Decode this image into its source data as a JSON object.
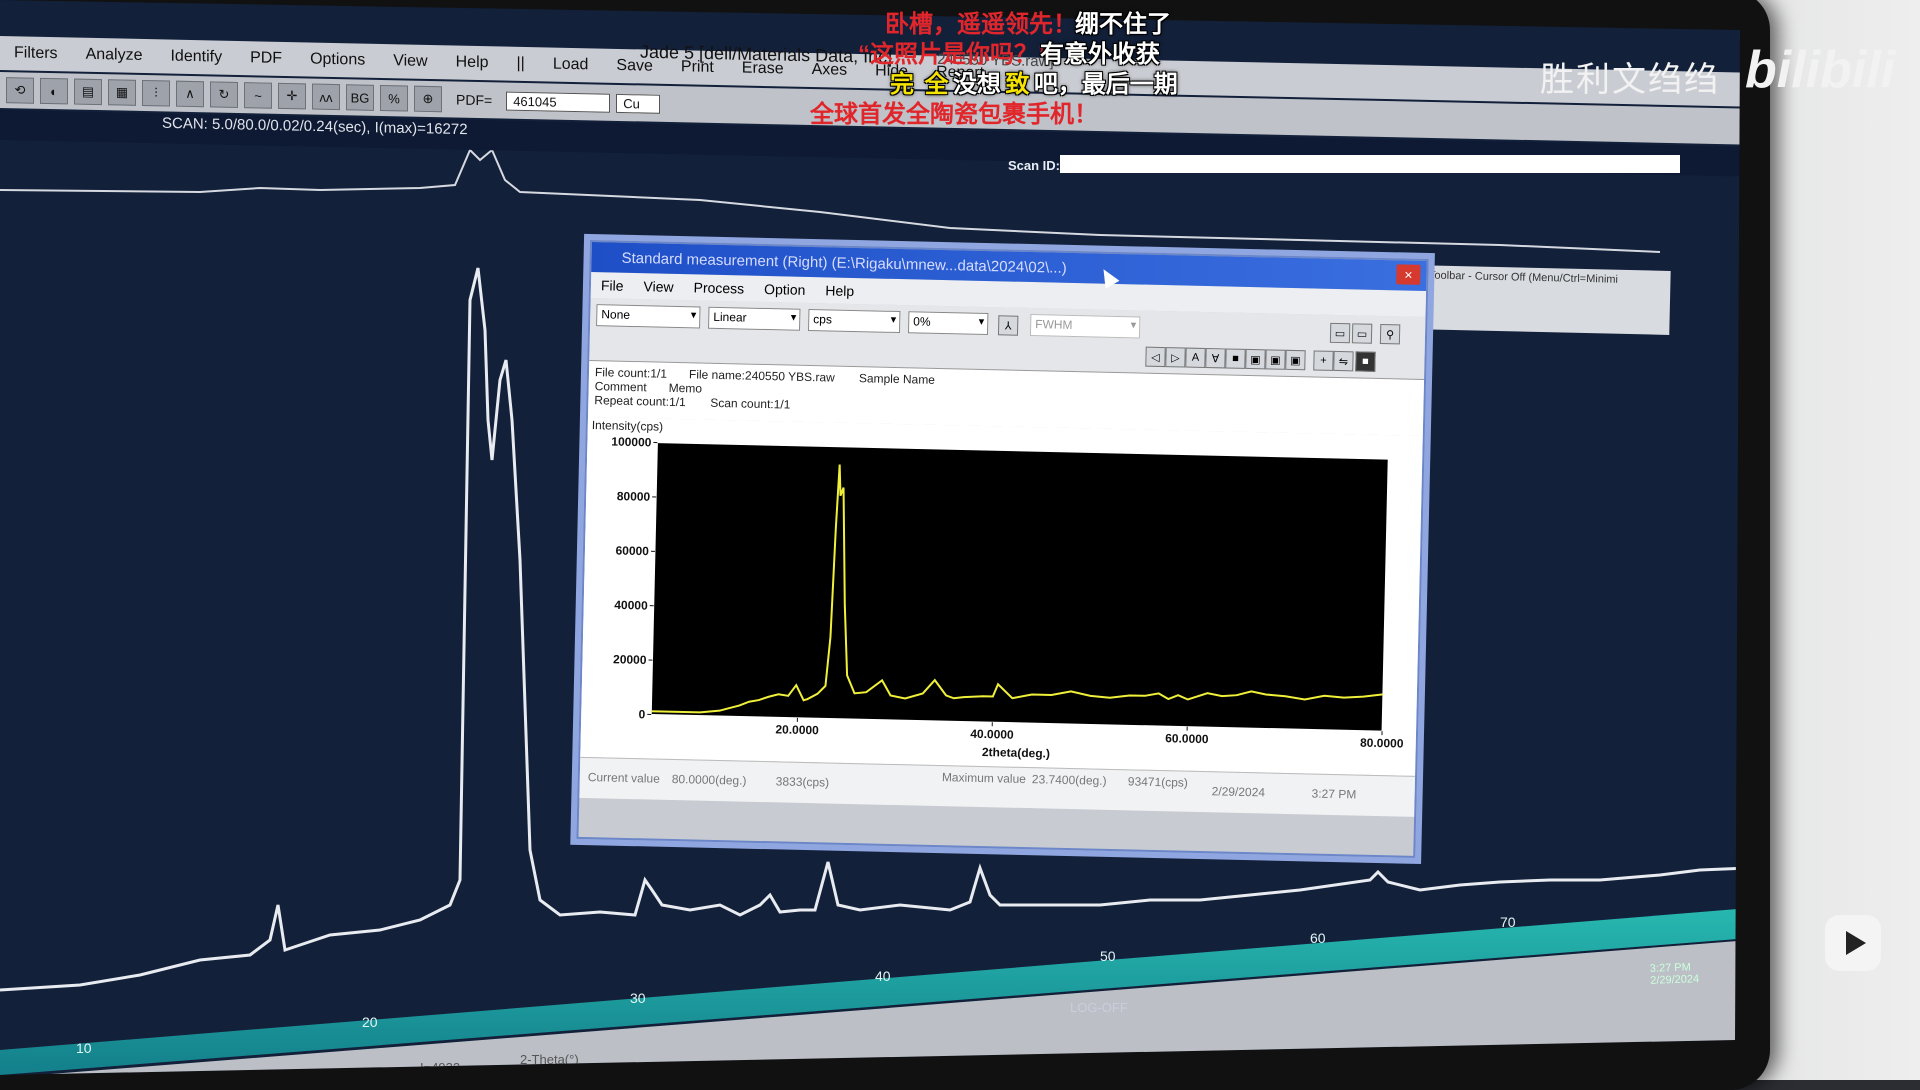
{
  "jade": {
    "menu": [
      "Filters",
      "Analyze",
      "Identify",
      "PDF",
      "Options",
      "View",
      "Help",
      "||",
      "Load",
      "Save",
      "Print",
      "Erase",
      "Axes",
      "Hide",
      "Report"
    ],
    "title": "Jade 5 [dell/Materials Data, Inc]",
    "title_tail": "240550 YBS.raw]",
    "pdf_label": "PDF=",
    "pdf_value": "461045",
    "target_value": "Cu",
    "scan_text": "SCAN: 5.0/80.0/0.02/0.24(sec), I(max)=16272",
    "scan_id_label": "Scan ID:",
    "edit_toolbar_text": "dit Toolbar - Cursor Off (Menu/Ctrl=Minimi",
    "axis_ticks": [
      "10",
      "20",
      "30",
      "40",
      "50",
      "60",
      "70"
    ],
    "bottom_label_a": "I=4932",
    "bottom_label_b": "2-Theta(°)",
    "log_off": "LOG-OFF",
    "tray_time": "3:27 PM",
    "tray_date": "2/29/2024"
  },
  "standard_measurement": {
    "title": "Standard measurement (Right) (E:\\Rigaku\\mnew...data\\2024\\02\\...)",
    "close": "×",
    "menu": [
      "File",
      "View",
      "Process",
      "Option",
      "Help"
    ],
    "dropdowns": [
      "None",
      "Linear",
      "cps",
      "0%"
    ],
    "fwhm": "FWHM",
    "info": {
      "file_count": "File count:1/1",
      "file_name": "File name:240550 YBS.raw",
      "sample_name": "Sample Name",
      "comment": "Comment",
      "memo": "Memo",
      "repeat_count": "Repeat count:1/1",
      "scan_count": "Scan count:1/1"
    },
    "status": {
      "current_label": "Current value",
      "current_deg": "80.0000(deg.)",
      "current_cps": "3833(cps)",
      "max_label": "Maximum value",
      "max_deg": "23.7400(deg.)",
      "max_cps": "93471(cps)",
      "date": "2/29/2024",
      "time": "3:27 PM"
    }
  },
  "chart_data": {
    "type": "line",
    "ylabel": "Intensity(cps)",
    "xlabel": "2theta(deg.)",
    "xlim": [
      5,
      80
    ],
    "ylim": [
      0,
      100000
    ],
    "x_ticks": [
      "20.0000",
      "40.0000",
      "60.0000",
      "80.0000"
    ],
    "y_ticks": [
      "0",
      "20000",
      "40000",
      "60000",
      "80000",
      "100000"
    ],
    "series": [
      {
        "color": "#f0f03a",
        "x": [
          5,
          10,
          12,
          13,
          14,
          15,
          16,
          17,
          18,
          19,
          19.8,
          20.6,
          21,
          22,
          22.8,
          23.2,
          23.5,
          23.74,
          23.9,
          24.2,
          24.6,
          25,
          25.8,
          27,
          28.6,
          29.5,
          31,
          32.8,
          34,
          35.2,
          36,
          37,
          39,
          40,
          40.5,
          42,
          44,
          46,
          48,
          50,
          52,
          54,
          55.6,
          57,
          58,
          59,
          60,
          62,
          63.5,
          65,
          66.5,
          68,
          70,
          72,
          74,
          76,
          78,
          80
        ],
        "y": [
          1200,
          1200,
          2000,
          3000,
          4000,
          5500,
          6200,
          7500,
          8500,
          8000,
          12000,
          6500,
          7000,
          9000,
          12000,
          30000,
          70000,
          93471,
          82000,
          85000,
          42000,
          16000,
          9500,
          10000,
          14500,
          9000,
          8000,
          10000,
          15000,
          9500,
          8500,
          9000,
          9500,
          9500,
          14000,
          9000,
          10500,
          10500,
          12000,
          10500,
          10000,
          11000,
          11000,
          12000,
          10000,
          11500,
          10000,
          12500,
          11500,
          12000,
          13500,
          12500,
          12000,
          11000,
          12500,
          12000,
          12500,
          13500
        ]
      }
    ]
  },
  "overlay": {
    "sub1_red": "卧槽，遥遥领先！",
    "sub1_white": "绷不住了",
    "sub2_red": "“这照片是你吗？”",
    "sub2_white": "有意外收获",
    "sub3_yellow1": "完",
    "sub3_yellow2": "全",
    "sub3_white1": "没想",
    "sub3_yellow3": "致",
    "sub3_white2": "吧，最后一期",
    "sub4_red": "全球首发全陶瓷包裹手机！",
    "watermark_name": "胜利文绉绉",
    "watermark_logo": "bilibili"
  }
}
